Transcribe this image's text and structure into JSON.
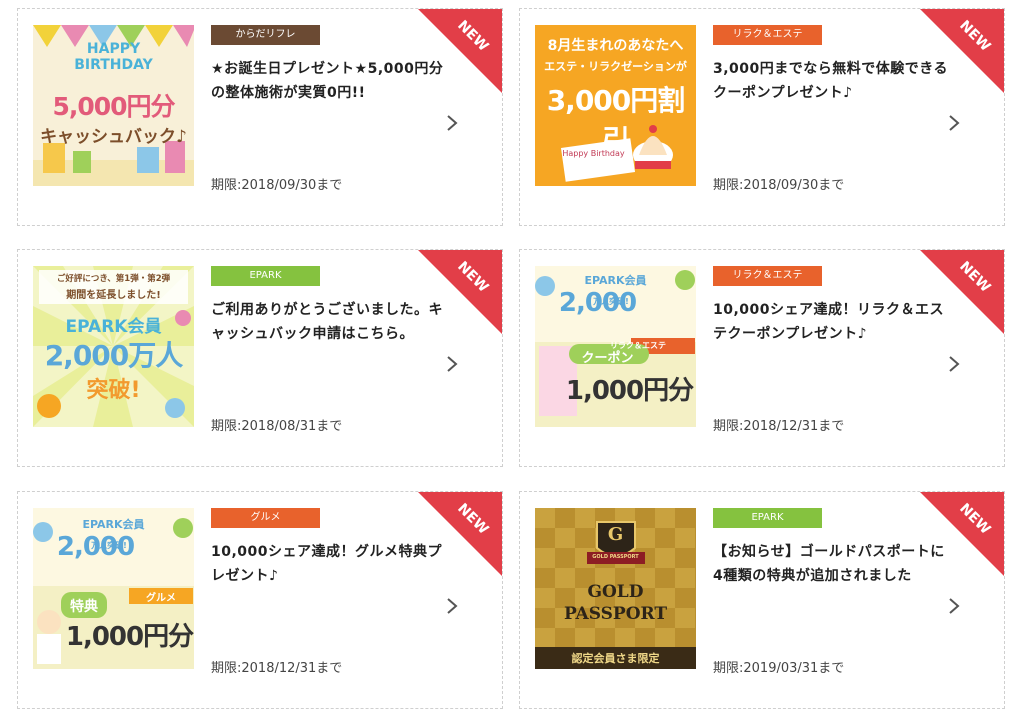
{
  "new_badge_text": "NEW",
  "colors": {
    "tag_brown": "#6b4a33",
    "tag_orange": "#e8622c",
    "tag_green": "#85c23f",
    "new_red": "#e23e48"
  },
  "cards": [
    {
      "tag": "からだリフレ",
      "tag_color": "#6b4a33",
      "title": "★お誕生日プレゼント★5,000円分の整体施術が実質0円!!",
      "expiry": "期限:2018/09/30まで",
      "image": {
        "line1": "HAPPY",
        "line2": "BIRTHDAY",
        "line3": "5,000円分",
        "line4": "キャッシュバック♪"
      }
    },
    {
      "tag": "リラク＆エステ",
      "tag_color": "#e8622c",
      "title": "3,000円までなら無料で体験できるクーポンプレゼント♪",
      "expiry": "期限:2018/09/30まで",
      "image": {
        "line1": "8月生まれのあなたへ",
        "line2": "エステ・リラクゼーションが",
        "line3": "3,000円割引",
        "line4": "Happy Birthday"
      }
    },
    {
      "tag": "EPARK",
      "tag_color": "#85c23f",
      "title": "ご利用ありがとうございました。キャッシュバック申請はこちら。",
      "expiry": "期限:2018/08/31まで",
      "image": {
        "line1": "ご好評につき、第1弾・第2弾",
        "line2": "期間を延長しました!",
        "line3": "EPARK会員",
        "line4": "2,000万人",
        "line5": "突破!"
      }
    },
    {
      "tag": "リラク＆エステ",
      "tag_color": "#e8622c",
      "title": "10,000シェア達成！リラク＆エステクーポンプレゼント♪",
      "expiry": "期限:2018/12/31まで",
      "image": {
        "line1": "EPARK会員",
        "line2": "2,000",
        "line3": "万人突破!",
        "line4": "リラク＆エステ",
        "line5": "クーポン",
        "line6": "1,000円分"
      }
    },
    {
      "tag": "グルメ",
      "tag_color": "#e8622c",
      "title": "10,000シェア達成！グルメ特典プレゼント♪",
      "expiry": "期限:2018/12/31まで",
      "image": {
        "line1": "EPARK会員",
        "line2": "2,000",
        "line3": "万人突破!",
        "line4": "グルメ",
        "line5": "特典",
        "line6": "1,000円分"
      }
    },
    {
      "tag": "EPARK",
      "tag_color": "#85c23f",
      "title": "【お知らせ】ゴールドパスポートに4種類の特典が追加されました",
      "expiry": "期限:2019/03/31まで",
      "image": {
        "line1": "G",
        "line2": "GOLD PASSPORT",
        "line3": "GOLD",
        "line4": "PASSPORT",
        "line5": "認定会員さま限定"
      }
    }
  ]
}
